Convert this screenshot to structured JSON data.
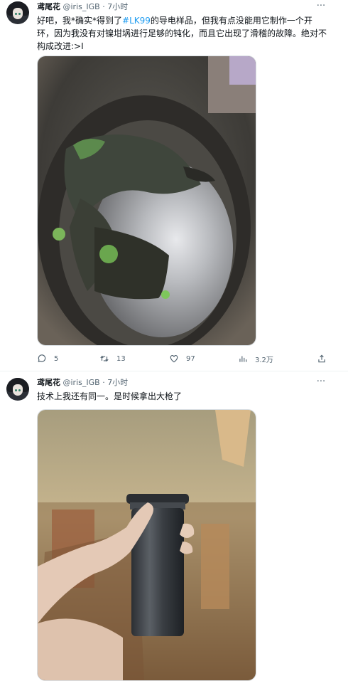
{
  "tweets": [
    {
      "user": {
        "name": "鸢尾花",
        "handle": "@iris_IGB",
        "time": "7小时"
      },
      "text_before": "好吧，我*确实*得到了",
      "hashtag": "#LK99",
      "text_after": "的导电样品，但我有点没能用它制作一个开环，因为我没有对镍坩埚进行足够的钝化，而且它出现了滑稽的故障。绝对不构成改进:>I",
      "image": {
        "description_icon": "crucible-interior-photo"
      },
      "actions": {
        "reply": "5",
        "retweet": "13",
        "like": "97",
        "views": "3.2万"
      }
    },
    {
      "user": {
        "name": "鸢尾花",
        "handle": "@iris_IGB",
        "time": "7小时"
      },
      "text": "技术上我还有同一。是时候拿出大枪了",
      "image": {
        "description_icon": "hand-holding-crucible-photo"
      }
    }
  ],
  "icons": {
    "more": "more-dots-icon",
    "reply": "reply-icon",
    "retweet": "retweet-icon",
    "like": "heart-icon",
    "views": "views-icon",
    "share": "share-icon"
  },
  "colors": {
    "accent": "#1d9bf0",
    "meta": "#536471"
  }
}
